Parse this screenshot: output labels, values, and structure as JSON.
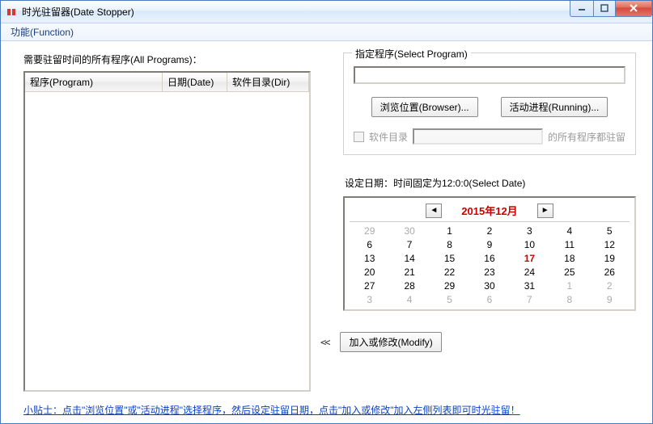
{
  "window": {
    "title": "时光驻留器(Date Stopper)"
  },
  "menu": {
    "function": "功能(Function)"
  },
  "left": {
    "heading": "需要驻留时间的所有程序(All Programs)：",
    "columns": {
      "program": "程序(Program)",
      "date": "日期(Date)",
      "dir": "软件目录(Dir)"
    }
  },
  "select_program": {
    "legend": "指定程序(Select Program)",
    "path_value": "",
    "browser_btn": "浏览位置(Browser)...",
    "running_btn": "活动进程(Running)...",
    "chk_label": "软件目录",
    "chk_suffix": "的所有程序都驻留"
  },
  "date_section": {
    "label": "设定日期：时间固定为12:0:0(Select Date)",
    "month_text": "2015年12月",
    "prev_glyph": "◄",
    "next_glyph": "►",
    "weeks": [
      [
        {
          "d": "29",
          "dim": true
        },
        {
          "d": "30",
          "dim": true
        },
        {
          "d": "1"
        },
        {
          "d": "2"
        },
        {
          "d": "3"
        },
        {
          "d": "4"
        },
        {
          "d": "5"
        }
      ],
      [
        {
          "d": "6"
        },
        {
          "d": "7"
        },
        {
          "d": "8"
        },
        {
          "d": "9"
        },
        {
          "d": "10"
        },
        {
          "d": "11"
        },
        {
          "d": "12"
        }
      ],
      [
        {
          "d": "13"
        },
        {
          "d": "14"
        },
        {
          "d": "15"
        },
        {
          "d": "16"
        },
        {
          "d": "17",
          "today": true
        },
        {
          "d": "18"
        },
        {
          "d": "19"
        }
      ],
      [
        {
          "d": "20"
        },
        {
          "d": "21"
        },
        {
          "d": "22"
        },
        {
          "d": "23"
        },
        {
          "d": "24"
        },
        {
          "d": "25"
        },
        {
          "d": "26"
        }
      ],
      [
        {
          "d": "27"
        },
        {
          "d": "28"
        },
        {
          "d": "29"
        },
        {
          "d": "30"
        },
        {
          "d": "31"
        },
        {
          "d": "1",
          "dim": true
        },
        {
          "d": "2",
          "dim": true
        }
      ],
      [
        {
          "d": "3",
          "dim": true
        },
        {
          "d": "4",
          "dim": true
        },
        {
          "d": "5",
          "dim": true
        },
        {
          "d": "6",
          "dim": true
        },
        {
          "d": "7",
          "dim": true
        },
        {
          "d": "8",
          "dim": true
        },
        {
          "d": "9",
          "dim": true
        }
      ]
    ]
  },
  "action": {
    "arrows": "<<",
    "modify_btn": "加入或修改(Modify)"
  },
  "tip": "小贴士：点击\"浏览位置\"或\"活动进程\"选择程序，然后设定驻留日期，点击\"加入或修改\"加入左侧列表即可时光驻留！"
}
